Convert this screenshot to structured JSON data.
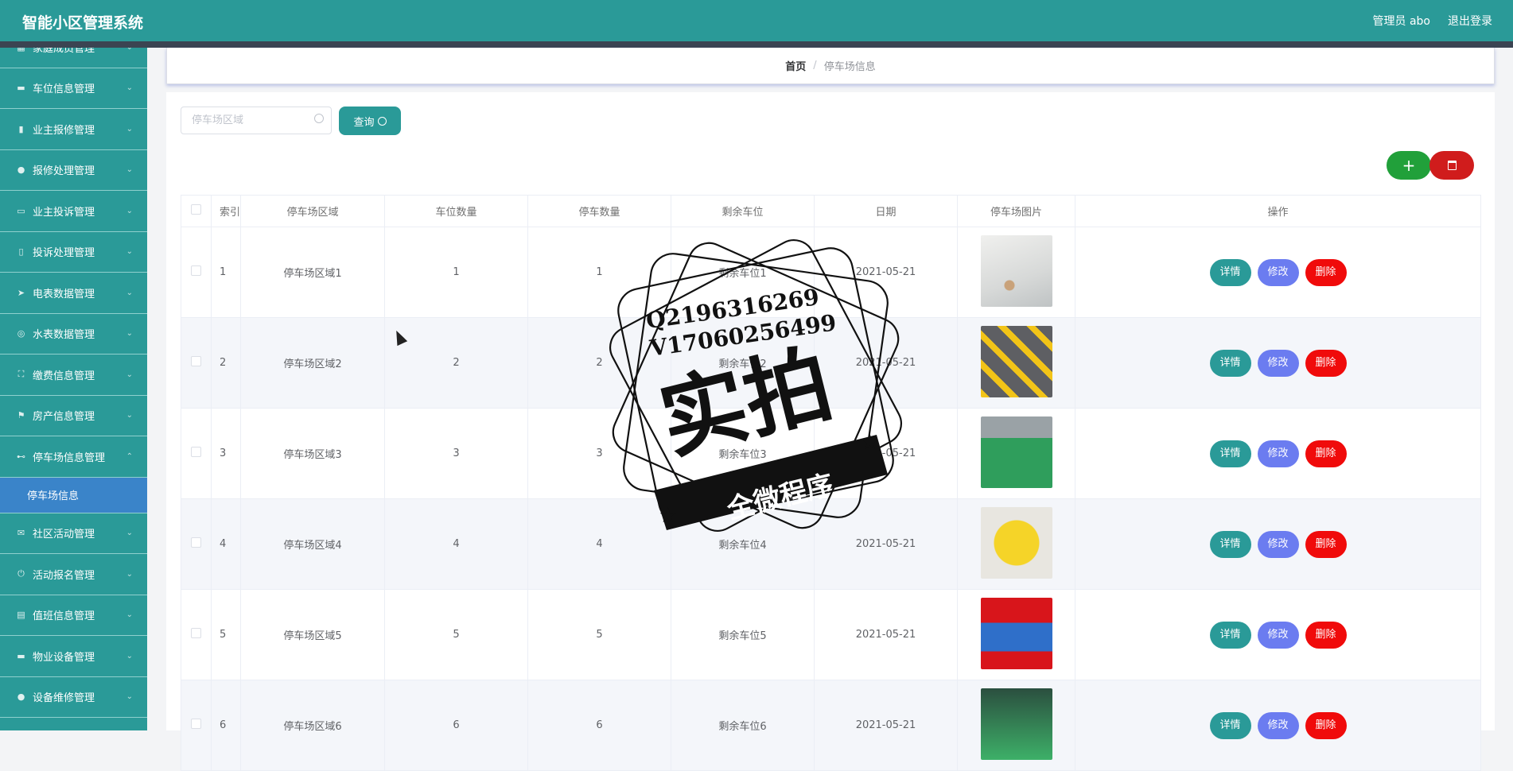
{
  "app": {
    "title": "智能小区管理系统",
    "user": "管理员 abo",
    "logout": "退出登录"
  },
  "sidebar": {
    "items": [
      {
        "label": "家庭成员管理",
        "icon": "table-icon"
      },
      {
        "label": "车位信息管理",
        "icon": "monitor-icon"
      },
      {
        "label": "业主报修管理",
        "icon": "chart-icon"
      },
      {
        "label": "报修处理管理",
        "icon": "user-icon"
      },
      {
        "label": "业主投诉管理",
        "icon": "message-icon"
      },
      {
        "label": "投诉处理管理",
        "icon": "mobile-icon"
      },
      {
        "label": "电表数据管理",
        "icon": "send-icon"
      },
      {
        "label": "水表数据管理",
        "icon": "compass-icon"
      },
      {
        "label": "缴费信息管理",
        "icon": "fullscreen-icon"
      },
      {
        "label": "房产信息管理",
        "icon": "flag-icon"
      },
      {
        "label": "停车场信息管理",
        "icon": "car-icon"
      }
    ],
    "active_sub": "停车场信息",
    "items_after": [
      {
        "label": "社区活动管理",
        "icon": "mail-icon"
      },
      {
        "label": "活动报名管理",
        "icon": "power-icon"
      },
      {
        "label": "值班信息管理",
        "icon": "clipboard-icon"
      },
      {
        "label": "物业设备管理",
        "icon": "monitor-icon"
      },
      {
        "label": "设备维修管理",
        "icon": "user-icon"
      }
    ]
  },
  "breadcrumb": {
    "home": "首页",
    "separator": "/",
    "current": "停车场信息"
  },
  "search": {
    "placeholder": "停车场区域",
    "button_label": "查询"
  },
  "table": {
    "headers": [
      "索引",
      "停车场区域",
      "车位数量",
      "停车数量",
      "剩余车位",
      "日期",
      "停车场图片",
      "操作"
    ],
    "rows": [
      {
        "index": "1",
        "area": "停车场区域1",
        "spaces": "1",
        "parked": "1",
        "remaining": "剩余车位1",
        "date": "2021-05-21"
      },
      {
        "index": "2",
        "area": "停车场区域2",
        "spaces": "2",
        "parked": "2",
        "remaining": "剩余车位2",
        "date": "2021-05-21"
      },
      {
        "index": "3",
        "area": "停车场区域3",
        "spaces": "3",
        "parked": "3",
        "remaining": "剩余车位3",
        "date": "2021-05-21"
      },
      {
        "index": "4",
        "area": "停车场区域4",
        "spaces": "4",
        "parked": "4",
        "remaining": "剩余车位4",
        "date": "2021-05-21"
      },
      {
        "index": "5",
        "area": "停车场区域5",
        "spaces": "5",
        "parked": "5",
        "remaining": "剩余车位5",
        "date": "2021-05-21"
      },
      {
        "index": "6",
        "area": "停车场区域6",
        "spaces": "6",
        "parked": "6",
        "remaining": "剩余车位6",
        "date": "2021-05-21"
      }
    ],
    "actions": {
      "detail": "详情",
      "edit": "修改",
      "delete": "删除"
    }
  },
  "watermark": {
    "line1": "Q2196316269",
    "line2": "V17060256499",
    "main": "实拍",
    "banner": "全微程序"
  },
  "colors": {
    "primary": "#2a9a98",
    "edit": "#6b7cf0",
    "danger": "#f00b0b",
    "add": "#21a03a"
  }
}
